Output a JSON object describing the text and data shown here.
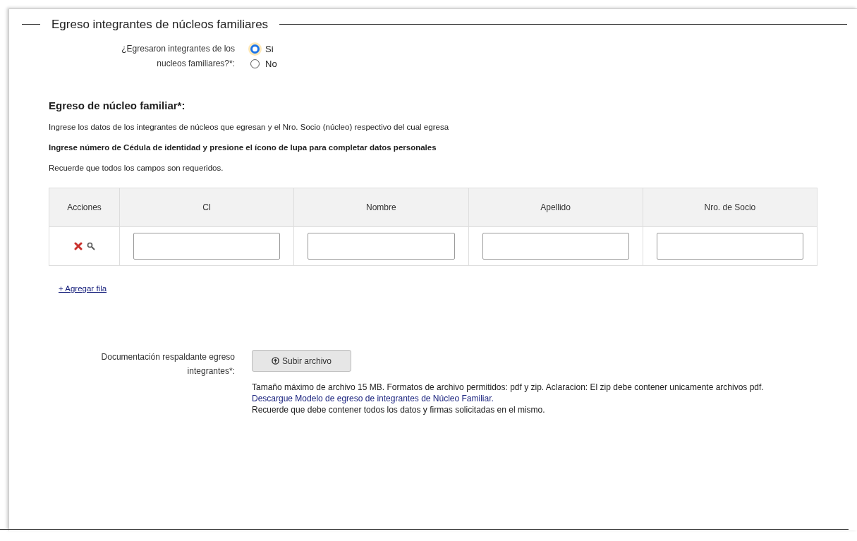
{
  "section": {
    "legend": "Egreso integrantes de núcleos familiares"
  },
  "question": {
    "label": "¿Egresaron integrantes de los nucleos familiares?*:",
    "options": [
      {
        "label": "Si",
        "selected": true
      },
      {
        "label": "No",
        "selected": false
      }
    ]
  },
  "subsection": {
    "title": "Egreso de núcleo familiar*:",
    "intro": "Ingrese los datos de los integrantes de núcleos que egresan y el Nro. Socio (núcleo) respectivo del cual egresa",
    "instruction": "Ingrese número de Cédula de identidad y presione el ícono de lupa para completar datos personales",
    "note": "Recuerde que todos los campos son requeridos."
  },
  "table": {
    "columns": [
      "Acciones",
      "CI",
      "Nombre",
      "Apellido",
      "Nro. de Socio"
    ],
    "rows": [
      {
        "fields": [
          {
            "kind": "text"
          },
          {
            "kind": "text"
          },
          {
            "kind": "text"
          },
          {
            "kind": "text"
          }
        ]
      }
    ]
  },
  "add_row_link": "+ Agregar fila",
  "upload": {
    "label": "Documentación respaldante egreso integrantes*:",
    "button": "Subir archivo",
    "help": "Tamaño máximo de archivo 15 MB. Formatos de archivo permitidos: pdf y zip. Aclaracion: El zip debe contener unicamente archivos pdf.",
    "download_link": "Descargue Modelo de egreso de integrantes de Núcleo Familiar.",
    "reminder": "Recuerde que debe contener todos los datos y firmas solicitadas en el mismo."
  }
}
